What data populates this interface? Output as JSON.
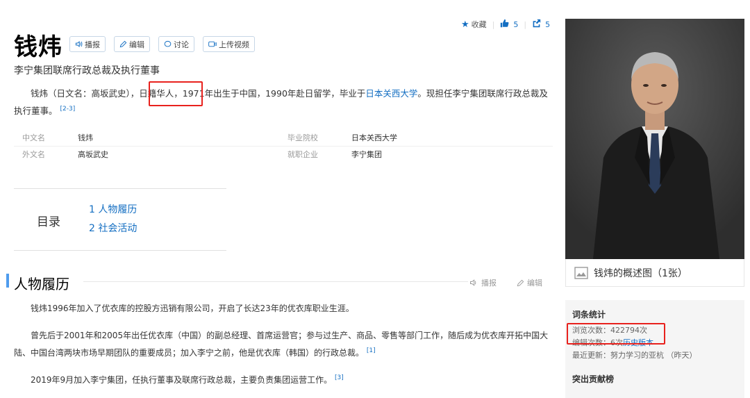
{
  "header": {
    "title": "钱炜",
    "buttons": [
      "播报",
      "编辑",
      "讨论",
      "上传视频"
    ],
    "subtitle": "李宁集团联席行政总裁及执行董事"
  },
  "topbar": {
    "favorite_label": "收藏",
    "like_count": "5",
    "share_count": "5"
  },
  "intro": {
    "p1": "钱炜（日文名：高坂武史），",
    "highlight": "日籍华人，",
    "p2": "1971年出生于中国，1990年赴日留学，毕业于",
    "link": "日本关西大学",
    "p3": "。现担任李宁集团联席行政总裁及执行董事。",
    "ref": "[2-3]"
  },
  "basic_info": [
    {
      "key": "中文名",
      "value": "钱炜",
      "key2": "毕业院校",
      "value2": "日本关西大学"
    },
    {
      "key": "外文名",
      "value": "高坂武史",
      "key2": "就职企业",
      "value2": "李宁集团"
    }
  ],
  "toc": {
    "label": "目录",
    "items": [
      "1  人物履历",
      "2  社会活动"
    ]
  },
  "section": {
    "title": "人物履历",
    "play_label": "播报",
    "edit_label": "编辑",
    "paragraphs": [
      {
        "text": "钱炜1996年加入了优衣库的控股方迅销有限公司，开启了长达23年的优衣库职业生涯。",
        "ref": ""
      },
      {
        "text": "曾先后于2001年和2005年出任优衣库（中国）的副总经理、首席运营官；参与过生产、商品、零售等部门工作，随后成为优衣库开拓中国大陆、中国台湾两块市场早期团队的重要成员；加入李宁之前，他是优衣库（韩国）的行政总裁。",
        "ref": "[1]"
      },
      {
        "text": "2019年9月加入李宁集团，任执行董事及联席行政总裁，主要负责集团运营工作。",
        "ref": "[3]"
      }
    ]
  },
  "sidebar": {
    "photo_caption": "钱炜的概述图（1张）",
    "stats_title": "词条统计",
    "views": "浏览次数：422794次",
    "edits_prefix": "编辑次数：6次",
    "edits_link": "历史版本",
    "updated": "最近更新：努力学习的亚杭 （昨天）",
    "contrib_title": "突出贡献榜"
  },
  "colors": {
    "link": "#136ec2",
    "highlight_box": "#e8211d",
    "section_bar": "#4f9cee"
  }
}
